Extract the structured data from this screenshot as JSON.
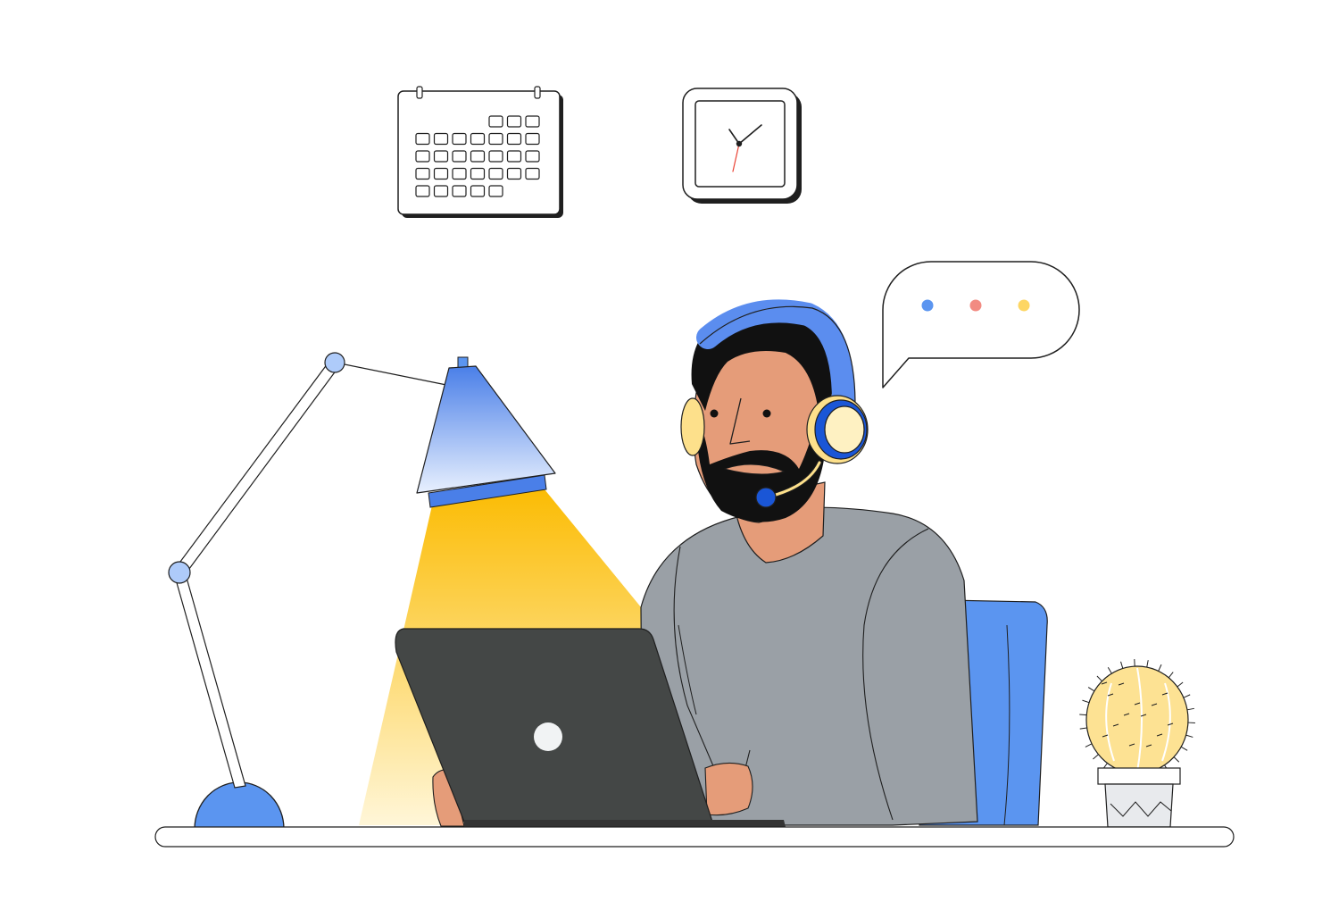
{
  "scene": {
    "description_elements": [
      "calendar-icon",
      "wall-clock-icon",
      "speech-bubble-icon",
      "desk-lamp",
      "person-with-headset",
      "laptop",
      "office-chair",
      "cactus-plant",
      "desk"
    ]
  },
  "calendar": {
    "rows": [
      {
        "count": 3,
        "offset": 4
      },
      {
        "count": 7,
        "offset": 0
      },
      {
        "count": 7,
        "offset": 0
      },
      {
        "count": 7,
        "offset": 0
      },
      {
        "count": 5,
        "offset": 0
      }
    ]
  },
  "speech_bubble": {
    "dots": [
      "#5B95F0",
      "#F28B82",
      "#FDD663"
    ]
  },
  "colors": {
    "outline": "#1f1f1f",
    "skin": "#E59C79",
    "hair": "#111111",
    "headset_blue": "#5B8DEF",
    "headset_dark_blue": "#1A56D6",
    "headset_yellow": "#FDE08B",
    "shirt": "#9AA0A6",
    "laptop": "#444746",
    "lamp_blue": "#5B95F0",
    "lamp_light_top": "#FBBC04",
    "lamp_light_bottom": "#FFF6D8",
    "chair": "#5B95F0",
    "cactus": "#FDE293",
    "pot": "#E8EAED"
  }
}
